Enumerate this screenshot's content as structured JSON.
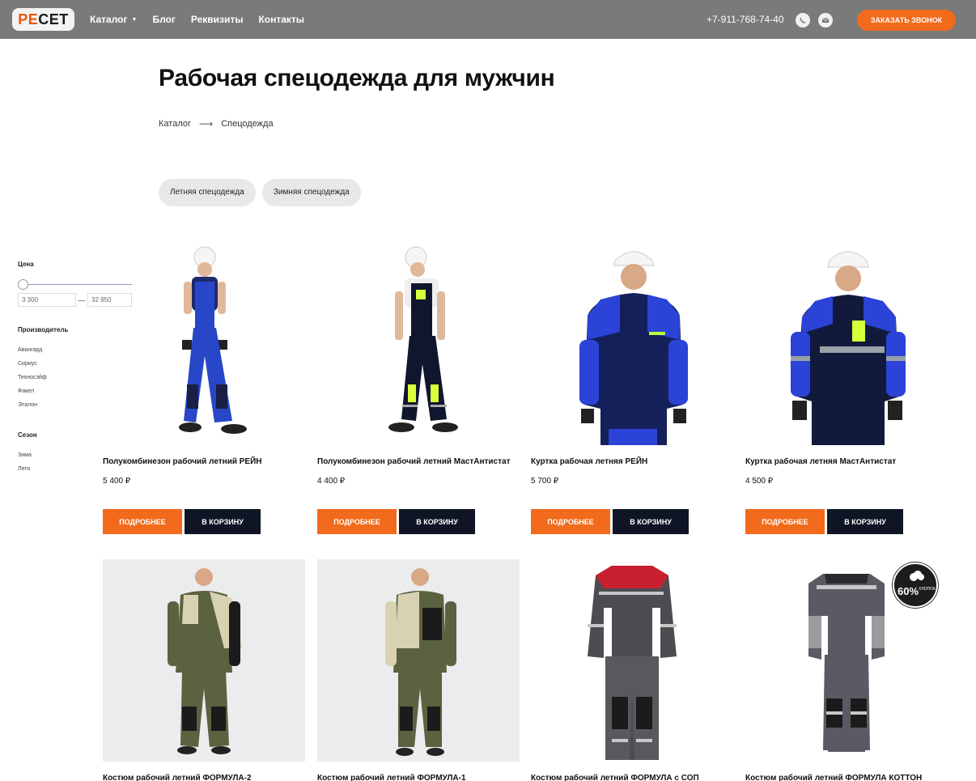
{
  "header": {
    "logo_a": "РЕ",
    "logo_b": "СЕТ",
    "nav": [
      {
        "label": "Каталог",
        "has_dropdown": true
      },
      {
        "label": "Блог"
      },
      {
        "label": "Реквизиты"
      },
      {
        "label": "Контакты"
      }
    ],
    "phone": "+7-911-768-74-40",
    "icons": [
      "viber-icon",
      "mail-icon"
    ],
    "call_button": "ЗАКАЗАТЬ ЗВОНОК"
  },
  "page": {
    "title": "Рабочая спецодежда для мужчин",
    "breadcrumb": [
      "Каталог",
      "Спецодежда"
    ],
    "chips": [
      "Летняя спецодежда",
      "Зимняя спецодежда"
    ]
  },
  "filters": {
    "price": {
      "title": "Цена",
      "min": "3 300",
      "max": "32 950"
    },
    "manufacturer": {
      "title": "Производитель",
      "items": [
        "Авангард",
        "Сириус",
        "Техносэйф",
        "Факел",
        "Эталон"
      ]
    },
    "season": {
      "title": "Сезон",
      "items": [
        "Зима",
        "Лето"
      ]
    }
  },
  "products": [
    {
      "name": "Полукомбинезон рабочий летний РЕЙН",
      "price": "5 400 ₽"
    },
    {
      "name": "Полукомбинезон рабочий летний МастАнтистат",
      "price": "4 400 ₽"
    },
    {
      "name": "Куртка рабочая летняя РЕЙН",
      "price": "5 700 ₽"
    },
    {
      "name": "Куртка рабочая летняя МастАнтистат",
      "price": "4 500 ₽"
    },
    {
      "name": "Костюм рабочий летний ФОРМУЛА-2"
    },
    {
      "name": "Костюм рабочий летний ФОРМУЛА-1"
    },
    {
      "name": "Костюм рабочий летний ФОРМУЛА с СОП"
    },
    {
      "name": "Костюм рабочий летний ФОРМУЛА КОТТОН"
    }
  ],
  "buttons": {
    "more": "ПОДРОБНЕЕ",
    "cart": "В КОРЗИНУ"
  },
  "badge": {
    "percent": "60%",
    "text": "ХЛОПОК"
  },
  "colors": {
    "accent": "#f26a1b",
    "dark": "#0f1524",
    "header": "#7a7a7a"
  }
}
